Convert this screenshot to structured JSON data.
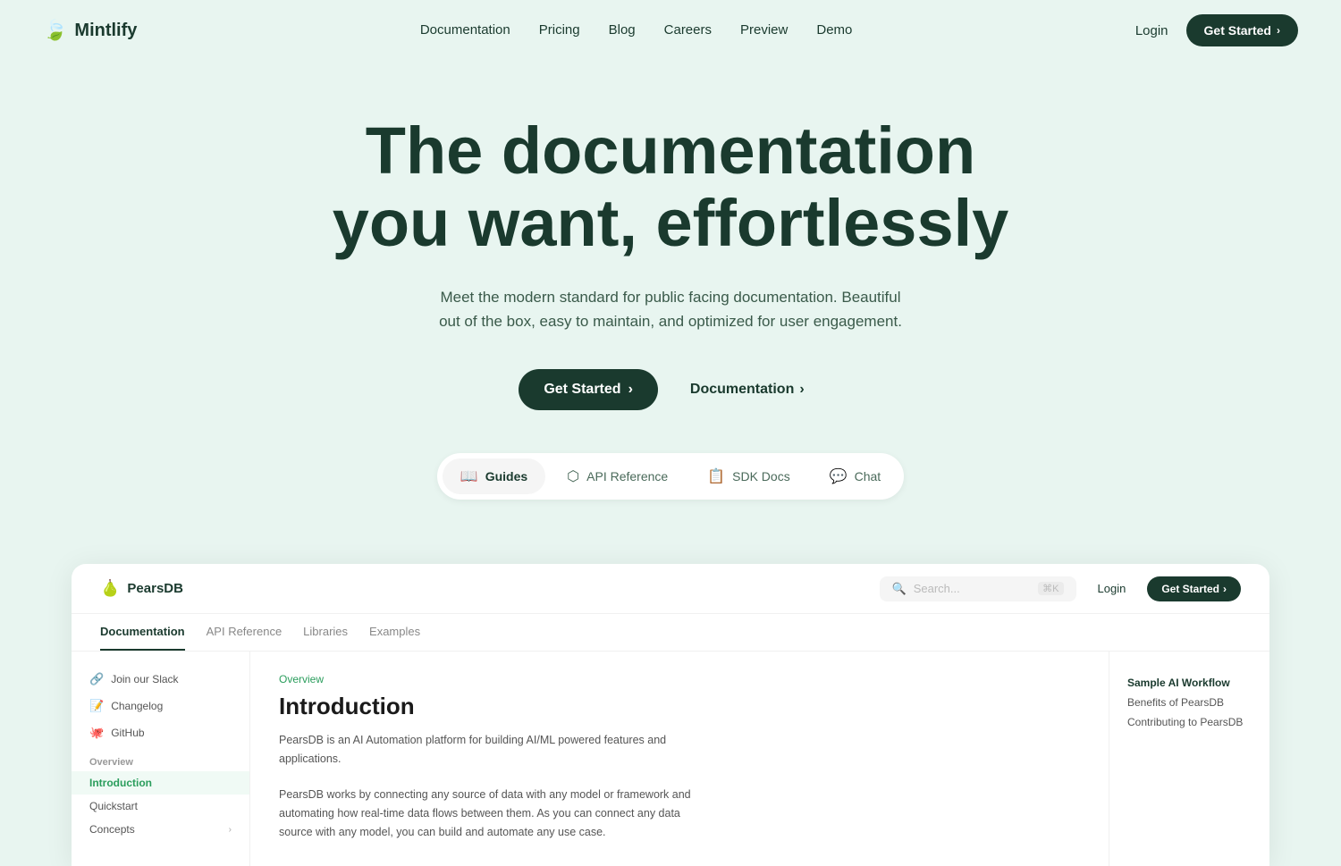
{
  "brand": {
    "name": "Mintlify",
    "logo_icon": "🍃"
  },
  "nav": {
    "links": [
      {
        "label": "Documentation",
        "href": "#"
      },
      {
        "label": "Pricing",
        "href": "#"
      },
      {
        "label": "Blog",
        "href": "#"
      },
      {
        "label": "Careers",
        "href": "#"
      },
      {
        "label": "Preview",
        "href": "#"
      },
      {
        "label": "Demo",
        "href": "#"
      }
    ],
    "login_label": "Login",
    "get_started_label": "Get Started",
    "chevron": "›"
  },
  "hero": {
    "title_line1": "The documentation",
    "title_line2": "you want, effortlessly",
    "subtitle": "Meet the modern standard for public facing documentation. Beautiful out of the box, easy to maintain, and optimized for user engagement.",
    "btn_get_started": "Get Started",
    "btn_documentation": "Documentation",
    "chevron": "›"
  },
  "tabs": [
    {
      "id": "guides",
      "label": "Guides",
      "icon": "📖",
      "active": true
    },
    {
      "id": "api-reference",
      "label": "API Reference",
      "icon": "⬡"
    },
    {
      "id": "sdk-docs",
      "label": "SDK Docs",
      "icon": "📋"
    },
    {
      "id": "chat",
      "label": "Chat",
      "icon": "💬"
    }
  ],
  "preview": {
    "brand": {
      "name": "PearsDB",
      "icon": "🍐"
    },
    "search_placeholder": "Search...",
    "search_shortcut": "⌘K",
    "nav_login": "Login",
    "nav_get_started": "Get Started",
    "nav_chevron": "›",
    "tabs": [
      {
        "label": "Documentation",
        "active": true
      },
      {
        "label": "API Reference"
      },
      {
        "label": "Libraries"
      },
      {
        "label": "Examples"
      }
    ],
    "sidebar": {
      "items": [
        {
          "icon": "🔗",
          "label": "Join our Slack"
        },
        {
          "icon": "📝",
          "label": "Changelog"
        },
        {
          "icon": "🐙",
          "label": "GitHub"
        }
      ],
      "section": "Overview",
      "links": [
        {
          "label": "Introduction",
          "active": true
        },
        {
          "label": "Quickstart"
        },
        {
          "label": "Concepts",
          "expandable": true
        }
      ]
    },
    "main": {
      "overview_label": "Overview",
      "title": "Introduction",
      "body1": "PearsDB is an AI Automation platform for building AI/ML powered features and applications.",
      "body2": "PearsDB works by connecting any source of data with any model or framework and automating how real-time data flows between them. As you can connect any data source with any model, you can build and automate any use case."
    },
    "right_sidebar": [
      {
        "label": "Sample AI Workflow",
        "active": true
      },
      {
        "label": "Benefits of PearsDB"
      },
      {
        "label": "Contributing to PearsDB"
      }
    ]
  },
  "colors": {
    "brand_dark": "#1a3a2e",
    "accent_green": "#2a9d5c",
    "bg": "#e8f5f0"
  }
}
